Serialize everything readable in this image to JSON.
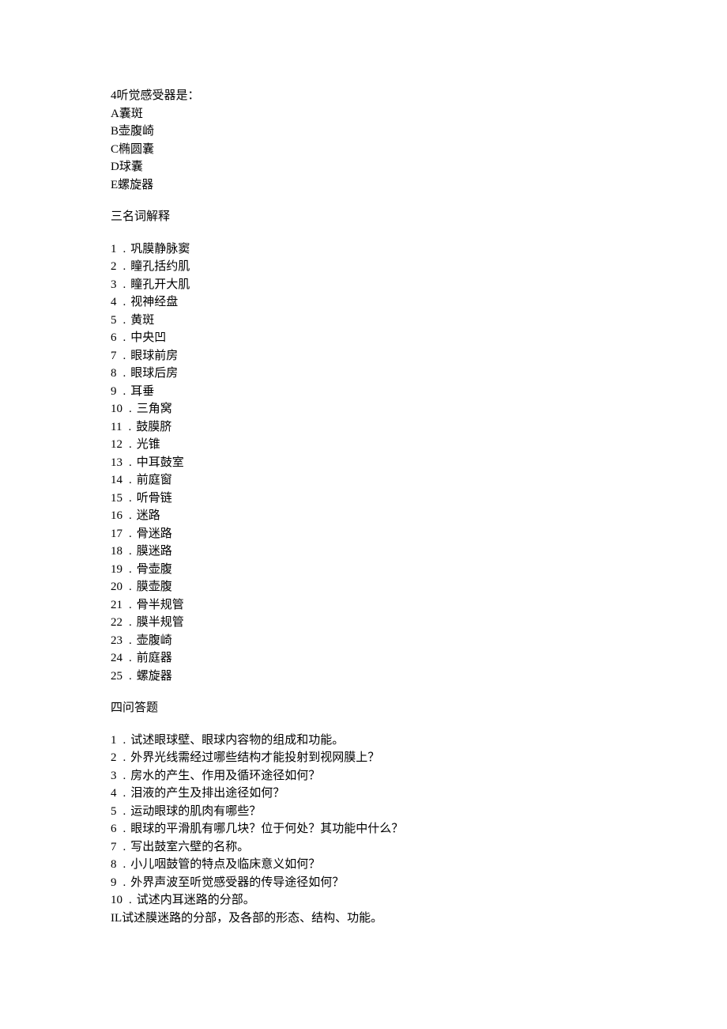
{
  "top_question": {
    "stem": "4听觉感受器是：",
    "options": [
      "A囊斑",
      "B壶腹崎",
      "C椭圆囊",
      "D球囊",
      "E螺旋器"
    ]
  },
  "section3": {
    "title": "三名词解释",
    "items": [
      "巩膜静脉窦",
      "瞳孔括约肌",
      "瞳孔开大肌",
      "视神经盘",
      "黄斑",
      "中央凹",
      "眼球前房",
      "眼球后房",
      "耳垂",
      "三角窝",
      "鼓膜脐",
      "光锥",
      "中耳鼓室",
      "前庭窗",
      "听骨链",
      "迷路",
      "骨迷路",
      "膜迷路",
      "骨壶腹",
      "膜壶腹",
      "骨半规管",
      "膜半规管",
      "壶腹崎",
      "前庭器",
      "螺旋器"
    ]
  },
  "section4": {
    "title": "四问答题",
    "items": [
      "试述眼球壁、眼球内容物的组成和功能。",
      "外界光线需经过哪些结构才能投射到视网膜上？",
      "房水的产生、作用及循环途径如何？",
      "泪液的产生及排出途径如何？",
      "运动眼球的肌肉有哪些？",
      "眼球的平滑肌有哪几块？位于何处？其功能中什么？",
      "写出鼓室六壁的名称。",
      "小儿咽鼓管的特点及临床意义如何？",
      "外界声波至听觉感受器的传导途径如何？",
      "试述内耳迷路的分部。"
    ],
    "tail": "IL试述膜迷路的分部，及各部的形态、结构、功能。"
  }
}
